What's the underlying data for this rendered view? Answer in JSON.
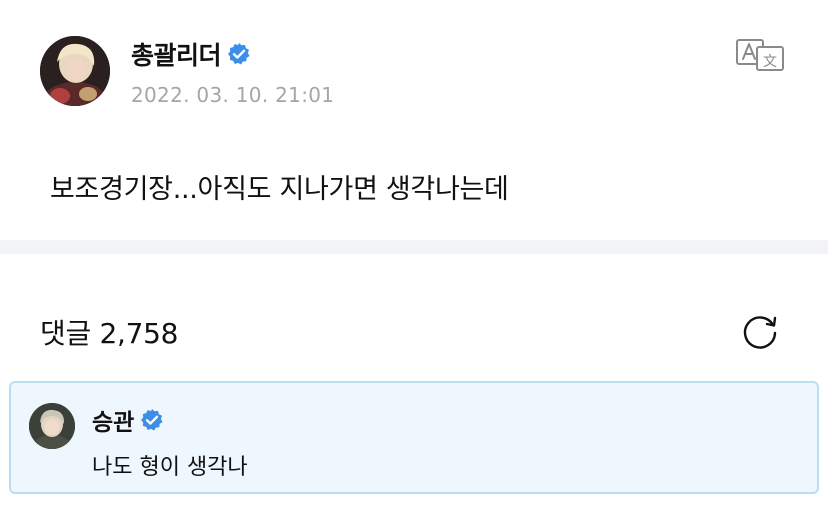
{
  "post": {
    "author": "총괄리더",
    "timestamp": "2022. 03. 10. 21:01",
    "body": "보조경기장...아직도 지나가면 생각나는데",
    "translate_icon": "translate-icon",
    "verified_icon": "verified-badge-icon"
  },
  "comments": {
    "header": "댓글 2,758",
    "refresh_icon": "refresh-icon",
    "items": [
      {
        "author": "승관",
        "text": "나도 형이 생각나",
        "verified_icon": "verified-badge-icon"
      }
    ]
  },
  "colors": {
    "verified": "#3d8ee6",
    "timestamp": "#a6a6a6",
    "divider": "#f2f3f6",
    "highlight_bg": "#eef7fd",
    "highlight_border": "#b9ddf3"
  }
}
